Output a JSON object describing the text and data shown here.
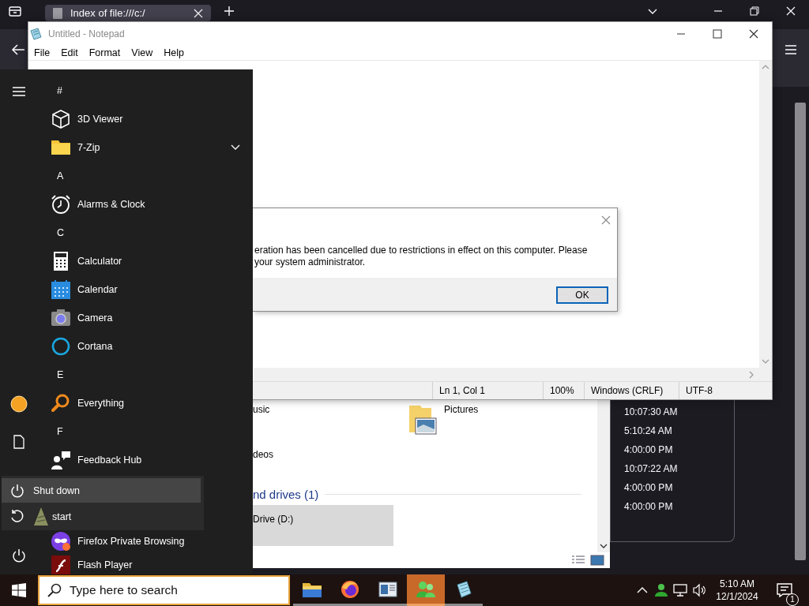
{
  "browser": {
    "tab_title": "Index of file:///c:/",
    "times": [
      "10:07:30 AM",
      "5:10:24 AM",
      "4:00:00 PM",
      "10:07:22 AM",
      "4:00:00 PM",
      "4:00:00 PM"
    ]
  },
  "explorer": {
    "items": [
      "usic",
      "Pictures",
      "deos"
    ],
    "group_header": "nd drives (1)",
    "drive": "Drive (D:)"
  },
  "notepad": {
    "title": "Untitled - Notepad",
    "menu": [
      "File",
      "Edit",
      "Format",
      "View",
      "Help"
    ],
    "status": [
      "Ln 1, Col 1",
      "100%",
      "Windows (CRLF)",
      "UTF-8"
    ]
  },
  "dialog": {
    "message_lines": [
      "eration has been cancelled due to restrictions in effect on this computer. Please",
      "your system administrator."
    ],
    "button": "OK"
  },
  "start_menu": {
    "apps": [
      {
        "kind": "header",
        "label": "#"
      },
      {
        "kind": "app",
        "label": "3D Viewer",
        "expandable": false
      },
      {
        "kind": "app",
        "label": "7-Zip",
        "expandable": true
      },
      {
        "kind": "header",
        "label": "A"
      },
      {
        "kind": "app",
        "label": "Alarms & Clock",
        "expandable": false
      },
      {
        "kind": "header",
        "label": "C"
      },
      {
        "kind": "app",
        "label": "Calculator",
        "expandable": false
      },
      {
        "kind": "app",
        "label": "Calendar",
        "expandable": false
      },
      {
        "kind": "app",
        "label": "Camera",
        "expandable": false
      },
      {
        "kind": "app",
        "label": "Cortana",
        "expandable": false
      },
      {
        "kind": "header",
        "label": "E"
      },
      {
        "kind": "app",
        "label": "Everything",
        "expandable": false
      },
      {
        "kind": "header",
        "label": "F"
      },
      {
        "kind": "app",
        "label": "Feedback Hub",
        "expandable": false
      }
    ],
    "power_menu": [
      {
        "label": "Shut down",
        "selected": true
      },
      {
        "label": "start",
        "selected": false
      }
    ],
    "more_apps": [
      {
        "kind": "app",
        "label": "Firefox Private Browsing",
        "expandable": false
      },
      {
        "kind": "app",
        "label": "Flash Player",
        "expandable": false
      }
    ]
  },
  "taskbar": {
    "search_placeholder": "Type here to search",
    "apps": [
      {
        "selected": false
      },
      {
        "selected": false
      },
      {
        "selected": false
      },
      {
        "selected": true
      },
      {
        "selected": false
      }
    ],
    "time": "5:10 AM",
    "date": "12/1/2024",
    "notification_count": "1"
  }
}
